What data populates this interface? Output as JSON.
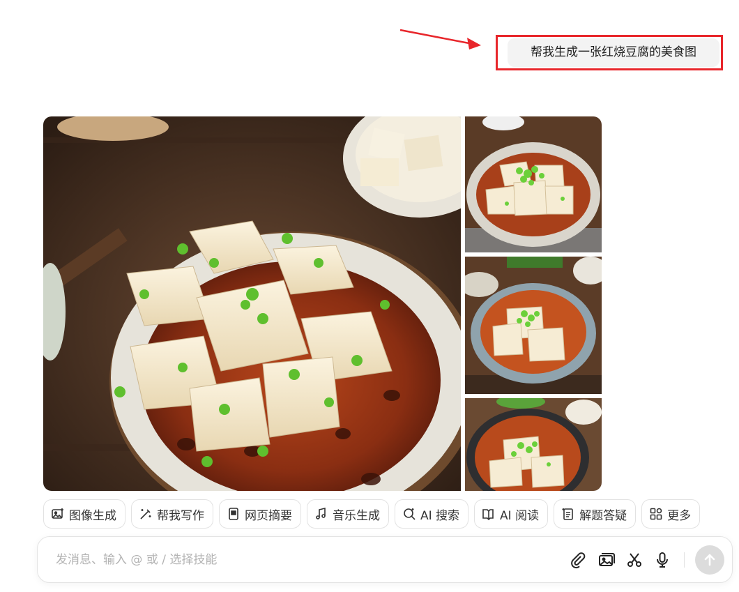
{
  "user_message": "帮我生成一张红烧豆腐的美食图",
  "gallery": {
    "images": [
      {
        "alt": "红烧豆腐 main"
      },
      {
        "alt": "红烧豆腐 variant 1"
      },
      {
        "alt": "红烧豆腐 variant 2"
      },
      {
        "alt": "红烧豆腐 variant 3"
      }
    ]
  },
  "skills": [
    {
      "label": "图像生成",
      "icon": "image-generate-icon"
    },
    {
      "label": "帮我写作",
      "icon": "magic-pen-icon"
    },
    {
      "label": "网页摘要",
      "icon": "webpage-summary-icon"
    },
    {
      "label": "音乐生成",
      "icon": "music-note-icon"
    },
    {
      "label": "AI 搜索",
      "icon": "ai-search-icon"
    },
    {
      "label": "AI 阅读",
      "icon": "ai-read-icon"
    },
    {
      "label": "解题答疑",
      "icon": "problem-solve-icon"
    },
    {
      "label": "更多",
      "icon": "more-apps-icon"
    }
  ],
  "composer": {
    "placeholder": "发消息、输入 @ 或 / 选择技能",
    "tools": [
      "attachment-icon",
      "image-upload-icon",
      "scissors-icon",
      "microphone-icon"
    ],
    "send_icon": "send-arrow-icon"
  },
  "colors": {
    "annotation_red": "#e8262b",
    "bubble_bg": "#f3f3f3",
    "send_disabled": "#dcdcdc"
  }
}
